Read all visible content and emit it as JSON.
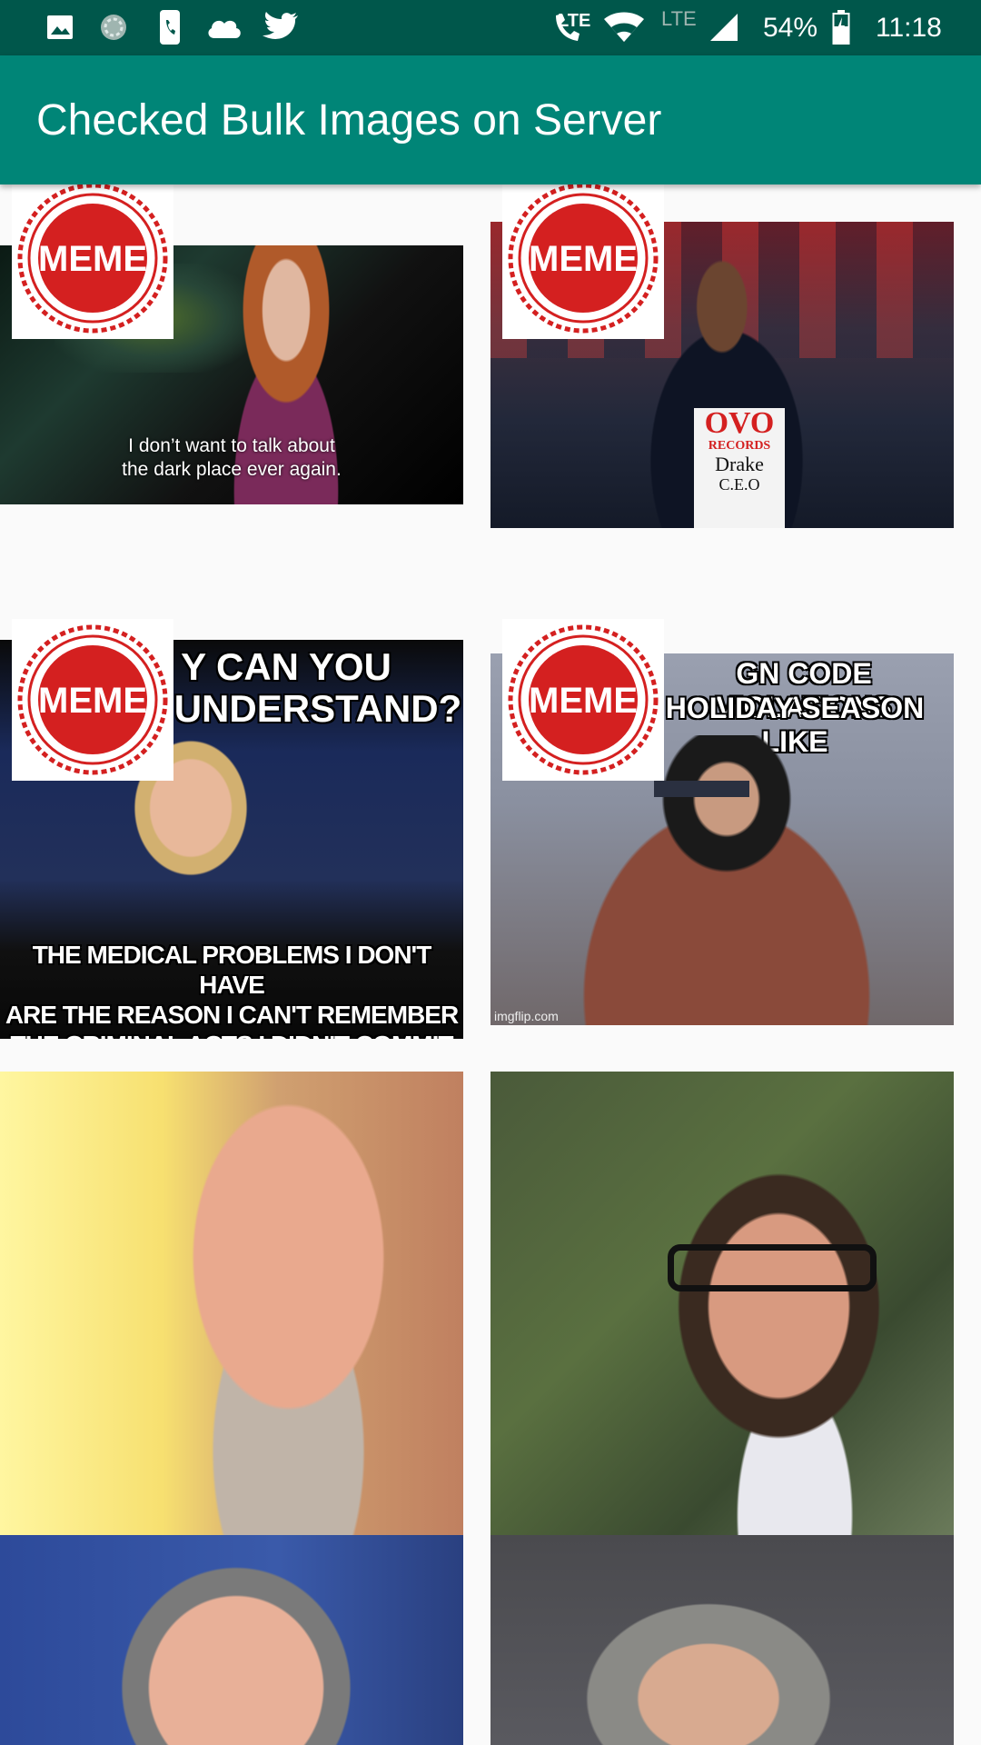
{
  "status_bar": {
    "network_label": "LTE",
    "network_label_2": "LTE",
    "battery": "54%",
    "time": "11:18",
    "icons": [
      "image-icon",
      "sync-icon",
      "phone-icon",
      "cloud-icon",
      "twitter-icon",
      "wifi-calling-icon",
      "wifi-icon",
      "signal-icon",
      "battery-icon"
    ]
  },
  "app_bar": {
    "title": "Checked Bulk Images on Server"
  },
  "badge": {
    "label": "MEME"
  },
  "tiles": [
    {
      "caption": "I don’t want to talk about\nthe dark place ever again."
    },
    {
      "shirt_line1": "OVO",
      "shirt_line2": "RECORDS",
      "shirt_line3": "Drake",
      "shirt_line4": "C.E.O"
    },
    {
      "top_text": "Y CAN YOU",
      "top_text2": "OT UNDERSTAND?",
      "bottom_text": "THE MEDICAL PROBLEMS I DON'T HAVE\nARE THE REASON I CAN'T REMEMBER\nTHE CRIMINAL ACTS I DIDN'T COMMIT"
    },
    {
      "top_text": "GN CODE VIOLATIONS",
      "top_text2": "HOLIDAY SEASON LIKE",
      "watermark": "imgflip.com"
    },
    {},
    {},
    {},
    {}
  ],
  "colors": {
    "status_bar": "#00574b",
    "app_bar": "#008577",
    "background": "#fafafa",
    "badge_red": "#d42020"
  }
}
